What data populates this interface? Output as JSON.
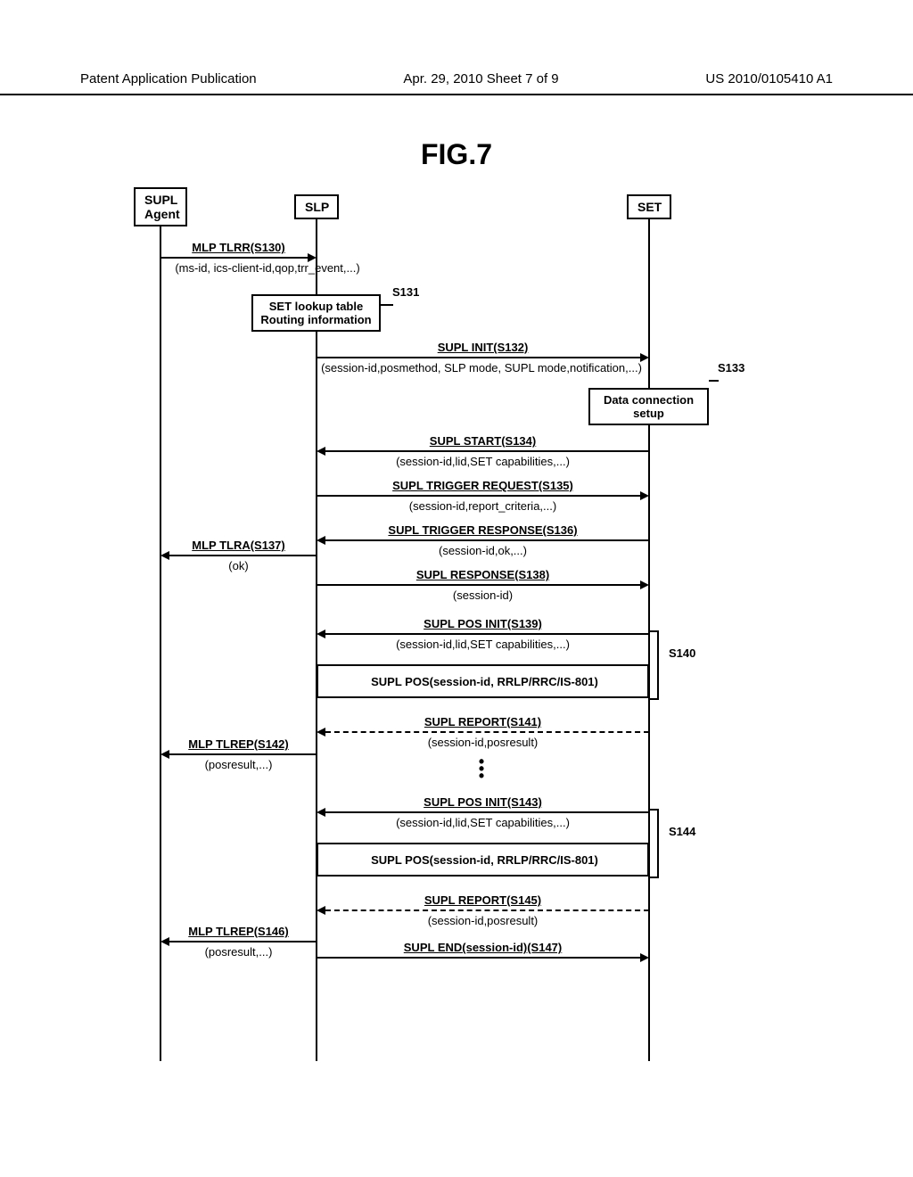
{
  "header": {
    "left": "Patent Application Publication",
    "center": "Apr. 29, 2010  Sheet 7 of 9",
    "right": "US 2010/0105410 A1"
  },
  "figure": "FIG.7",
  "actors": {
    "agent": "SUPL\nAgent",
    "slp": "SLP",
    "set": "SET"
  },
  "notes": {
    "lookup": "SET lookup table\nRouting information",
    "dataconn": "Data connection\nsetup"
  },
  "steps": {
    "s131": "S131",
    "s133": "S133",
    "s140": "S140",
    "s144": "S144"
  },
  "msgs": {
    "m130": {
      "t": "MLP TLRR(S130)",
      "b": "(ms-id, ics-client-id,qop,trr_event,...)"
    },
    "m132": {
      "t": "SUPL INIT(S132)",
      "b": "(session-id,posmethod, SLP mode, SUPL mode,notification,...)"
    },
    "m134": {
      "t": "SUPL START(S134)",
      "b": "(session-id,lid,SET capabilities,...)"
    },
    "m135": {
      "t": "SUPL TRIGGER REQUEST(S135)",
      "b": "(session-id,report_criteria,...)"
    },
    "m136": {
      "t": "SUPL TRIGGER RESPONSE(S136)",
      "b": "(session-id,ok,...)"
    },
    "m137": {
      "t": "MLP TLRA(S137)",
      "b": "(ok)"
    },
    "m138": {
      "t": "SUPL RESPONSE(S138)",
      "b": "(session-id)"
    },
    "m139": {
      "t": "SUPL POS INIT(S139)",
      "b": "(session-id,lid,SET capabilities,...)"
    },
    "m140box": "SUPL POS(session-id, RRLP/RRC/IS-801)",
    "m141": {
      "t": "SUPL REPORT(S141)",
      "b": "(session-id,posresult)"
    },
    "m142": {
      "t": "MLP TLREP(S142)",
      "b": "(posresult,...)"
    },
    "m143": {
      "t": "SUPL POS INIT(S143)",
      "b": "(session-id,lid,SET capabilities,...)"
    },
    "m144box": "SUPL POS(session-id, RRLP/RRC/IS-801)",
    "m145": {
      "t": "SUPL REPORT(S145)",
      "b": "(session-id,posresult)"
    },
    "m146": {
      "t": "MLP TLREP(S146)",
      "b": "(posresult,...)"
    },
    "m147": {
      "t": "SUPL END(session-id)(S147)"
    }
  }
}
